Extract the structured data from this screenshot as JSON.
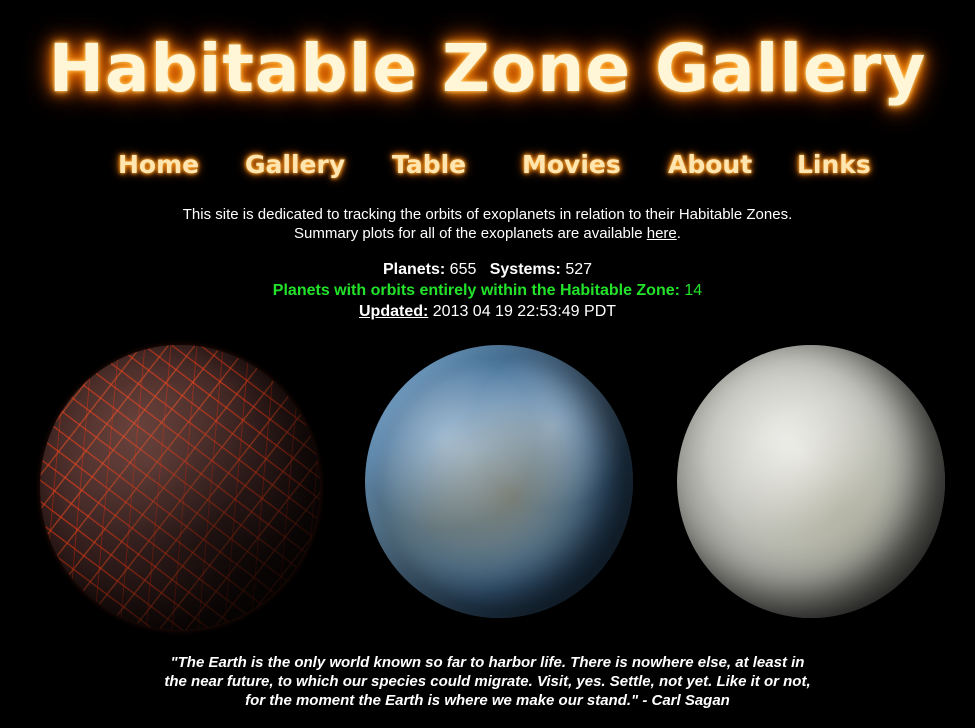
{
  "site": {
    "title": "Habitable Zone Gallery"
  },
  "nav": {
    "items": [
      {
        "label": "Home"
      },
      {
        "label": "Gallery"
      },
      {
        "label": "Table"
      },
      {
        "label": "Movies"
      },
      {
        "label": "About"
      },
      {
        "label": "Links"
      }
    ]
  },
  "intro": {
    "line1": "This site is dedicated to tracking the orbits of exoplanets in relation to their Habitable Zones.",
    "line2_prefix": "Summary plots for all of the exoplanets are available ",
    "line2_link": "here",
    "line2_suffix": "."
  },
  "stats": {
    "planets_label": "Planets:",
    "planets_value": "655",
    "systems_label": "Systems:",
    "systems_value": "527",
    "habitable_label": "Planets with orbits entirely within the Habitable Zone:",
    "habitable_value": "14",
    "updated_label": "Updated:",
    "updated_value": "2013 04 19 22:53:49 PDT",
    "habitable_color": "#22e22a"
  },
  "images": [
    {
      "icon": "lava-planet-image"
    },
    {
      "icon": "earth-like-planet-image"
    },
    {
      "icon": "ice-planet-image"
    }
  ],
  "quote": {
    "line1": "\"The Earth is the only world known so far to harbor life. There is nowhere else, at least in",
    "line2": "the near future, to which our species could migrate. Visit, yes. Settle, not yet. Like it or not,",
    "line3": "for the moment the Earth is where we make our stand.\" - Carl Sagan"
  },
  "colors": {
    "background": "#000000",
    "glow": "#ff8a00",
    "text": "#ffffff"
  }
}
